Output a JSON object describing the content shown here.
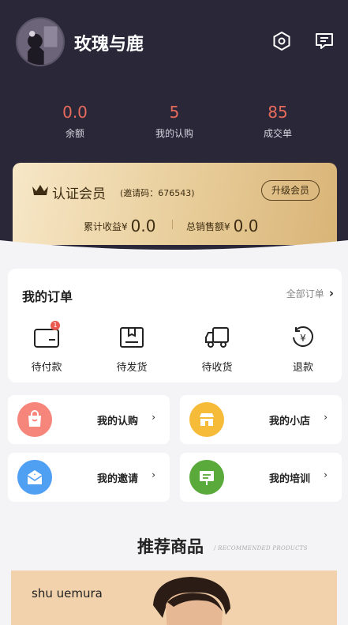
{
  "profile": {
    "username": "玫瑰与鹿"
  },
  "header_icons": [
    "settings-icon",
    "message-icon"
  ],
  "stats": [
    {
      "value": "0.0",
      "label": "余额"
    },
    {
      "value": "5",
      "label": "我的认购"
    },
    {
      "value": "85",
      "label": "成交单"
    }
  ],
  "member": {
    "title": "认证会员",
    "invite": "(邀请码：676543)",
    "upgrade": "升级会员",
    "cumulative_label": "累计收益¥",
    "cumulative_value": "0.0",
    "sales_label": "总销售额¥",
    "sales_value": "0.0"
  },
  "orders": {
    "title": "我的订单",
    "all_label": "全部订单",
    "items": [
      {
        "label": "待付款",
        "icon": "wallet-icon",
        "badge": "1"
      },
      {
        "label": "待发货",
        "icon": "box-icon"
      },
      {
        "label": "待收货",
        "icon": "truck-icon"
      },
      {
        "label": "退款",
        "icon": "refund-icon"
      }
    ]
  },
  "tiles": [
    {
      "label": "我的认购",
      "icon": "shopping-bag-icon",
      "color": "#f6857c"
    },
    {
      "label": "我的小店",
      "icon": "store-icon",
      "color": "#f7bb3a"
    },
    {
      "label": "我的邀请",
      "icon": "envelope-icon",
      "color": "#4f9ff2"
    },
    {
      "label": "我的培训",
      "icon": "training-icon",
      "color": "#5aaa3b"
    }
  ],
  "recommend": {
    "title": "推荐商品",
    "subtitle": "/ RECOMMENDED PRODUCTS"
  },
  "banner": {
    "brand": "shu uemura"
  },
  "colors": {
    "header_bg": "#2a2838",
    "accent": "#e86a5d",
    "gold": "#e9cf9d"
  }
}
